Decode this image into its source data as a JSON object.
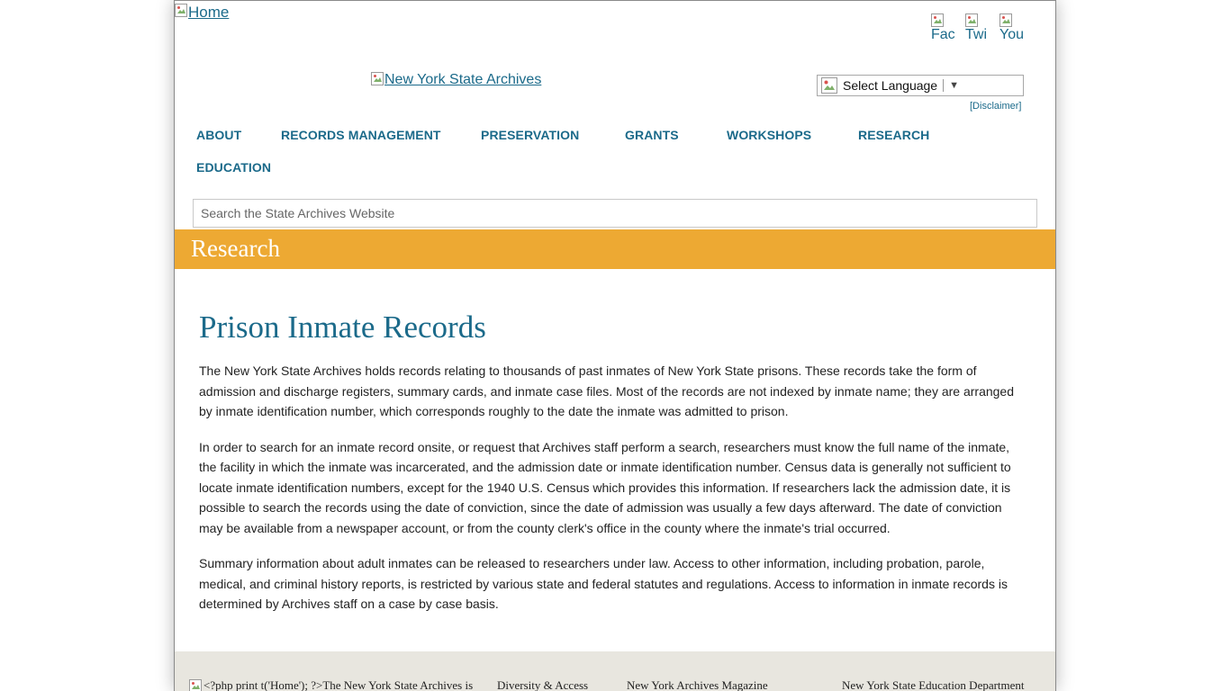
{
  "header": {
    "home_logo_alt": "Home",
    "archives_logo_alt": "New York State Archives",
    "social": [
      {
        "label": "Fac"
      },
      {
        "label": "Twi"
      },
      {
        "label": "You"
      }
    ],
    "language_select": "Select Language",
    "disclaimer": "[Disclaimer]"
  },
  "nav": [
    {
      "label": "ABOUT"
    },
    {
      "label": "RECORDS MANAGEMENT"
    },
    {
      "label": "PRESERVATION"
    },
    {
      "label": "GRANTS"
    },
    {
      "label": "WORKSHOPS"
    },
    {
      "label": "RESEARCH"
    },
    {
      "label": "EDUCATION"
    }
  ],
  "search": {
    "placeholder": "Search the State Archives Website"
  },
  "section_title": "Research",
  "content": {
    "title": "Prison Inmate Records",
    "paragraphs": [
      "The New York State Archives holds records relating to thousands of past inmates of New York State prisons. These records take the form of admission and discharge registers, summary cards, and inmate case files.  Most of the records are not indexed by inmate name; they are arranged by inmate identification number, which corresponds roughly to the date the inmate was admitted to prison.",
      "In order to search for an inmate record onsite, or request that Archives staff perform a search, researchers must know the full name of the inmate, the facility in which the inmate was incarcerated, and the admission date or inmate identification number. Census data is generally not sufficient to locate inmate identification numbers, except for the 1940 U.S. Census which provides this information. If researchers lack the admission date, it is possible to search the records using the date of conviction, since the date of admission was usually a few days afterward. The date of conviction may be available from a newspaper account, or from the county clerk's office in the county where the inmate's trial occurred.",
      "Summary information about adult inmates can be released to researchers under law.  Access to other information, including probation, parole, medical, and criminal history reports, is restricted by various state and federal statutes and regulations.  Access to information in inmate records is determined by Archives staff on a case by case basis."
    ]
  },
  "footer": {
    "items": [
      {
        "label": "<?php print t('Home'); ?>The New York State Archives is"
      },
      {
        "label": "Diversity & Access"
      },
      {
        "label": "New York Archives Magazine"
      },
      {
        "label": "New York State Education Department"
      }
    ]
  },
  "colors": {
    "link": "#1b6a8a",
    "banner": "#eda933",
    "footer_bg": "#e8e6df"
  }
}
